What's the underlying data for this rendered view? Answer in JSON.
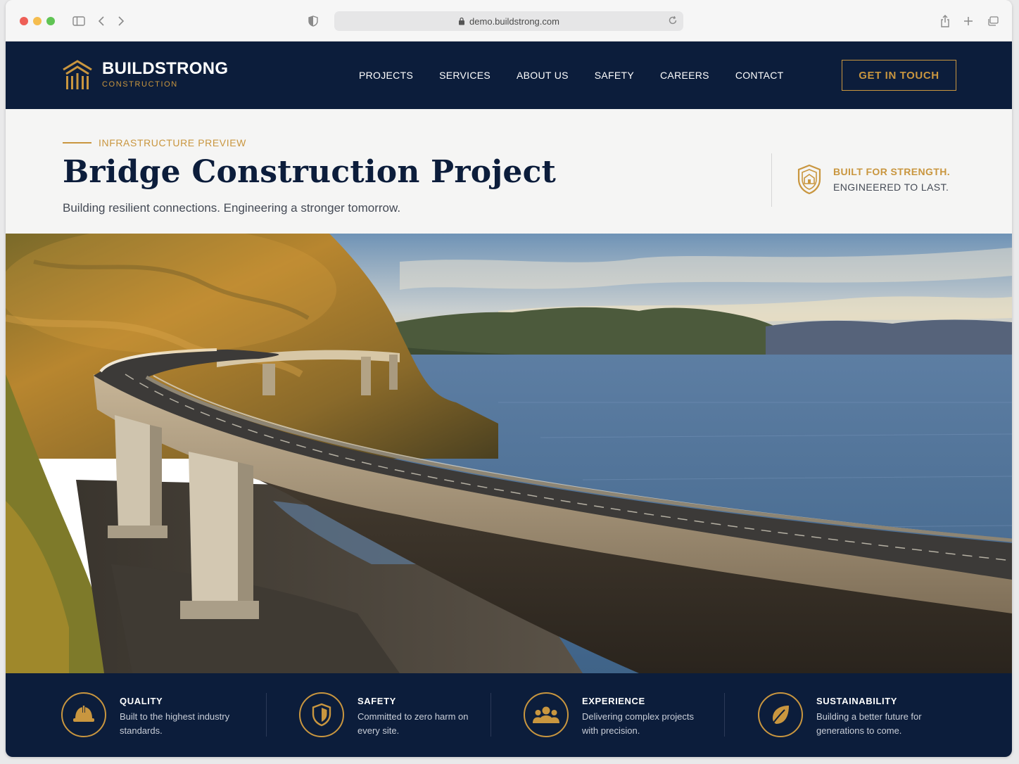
{
  "browser": {
    "url": "demo.buildstrong.com"
  },
  "header": {
    "brand_name": "BUILDSTRONG",
    "brand_sub": "CONSTRUCTION",
    "nav": [
      "PROJECTS",
      "SERVICES",
      "ABOUT US",
      "SAFETY",
      "CAREERS",
      "CONTACT"
    ],
    "cta_label": "GET IN TOUCH"
  },
  "intro": {
    "eyebrow": "INFRASTRUCTURE PREVIEW",
    "title": "Bridge Construction Project",
    "subtitle": "Building resilient connections. Engineering a stronger tomorrow.",
    "tagline_1": "BUILT FOR STRENGTH.",
    "tagline_2": "ENGINEERED TO LAST."
  },
  "features": [
    {
      "icon": "hard-hat-icon",
      "title": "QUALITY",
      "text": "Built to the highest industry standards."
    },
    {
      "icon": "shield-icon",
      "title": "SAFETY",
      "text": "Committed to zero harm on every site."
    },
    {
      "icon": "team-icon",
      "title": "EXPERIENCE",
      "text": "Delivering complex projects with precision."
    },
    {
      "icon": "leaf-icon",
      "title": "SUSTAINABILITY",
      "text": "Building a better future for generations to come."
    }
  ],
  "colors": {
    "navy": "#0c1d3b",
    "gold": "#c9963f",
    "band": "#f5f5f4"
  }
}
